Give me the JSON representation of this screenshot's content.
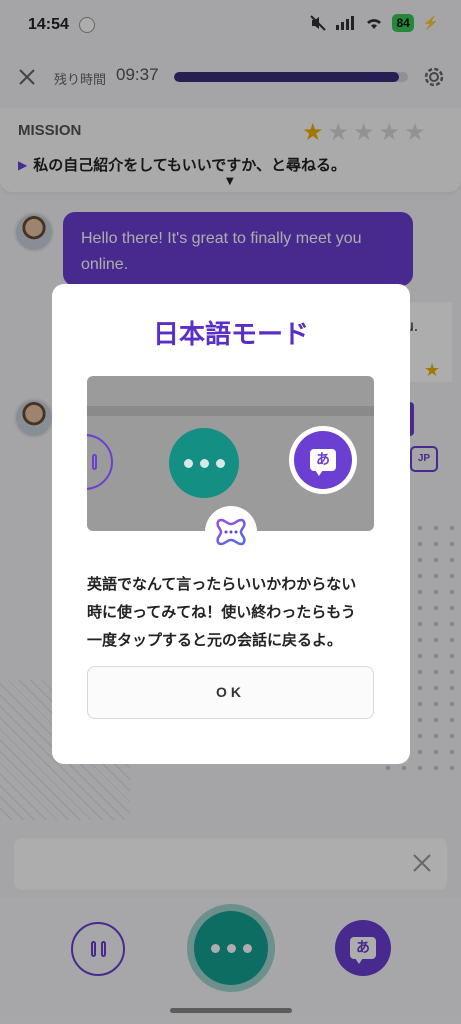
{
  "status_bar": {
    "time": "14:54",
    "battery": "84"
  },
  "header": {
    "remaining_label": "残り時間",
    "remaining_time": "09:37",
    "progress": 0.96
  },
  "mission": {
    "title": "MISSION",
    "stars_filled": 1,
    "stars_total": 5,
    "text": "私の自己紹介をしてもいいですか、と尋ねる。"
  },
  "chat": {
    "bubble_1": "Hello there! It's great to finally meet you online.",
    "bubble_2_visible": "ou.",
    "jp_badge": "JP"
  },
  "modal": {
    "title": "日本語モード",
    "illustration_button_label": "あ",
    "body_line_1": "英語でなんて言ったらいいかわからない",
    "body_line_2": "時に使ってみてね！使い終わったらもう",
    "body_line_3": "一度タップすると元の会話に戻るよ。",
    "ok_label": "OK"
  },
  "bottom": {
    "jp_mode_label": "あ"
  },
  "colors": {
    "accent": "#6a3fd1",
    "teal": "#14a192",
    "star": "#f2b000"
  }
}
